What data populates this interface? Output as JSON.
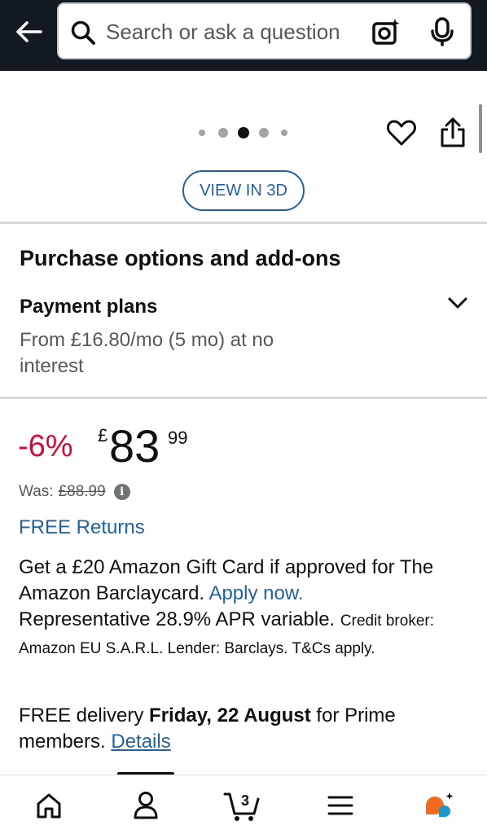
{
  "header": {
    "search_placeholder": "Search or ask a question",
    "back_icon": "arrow-left-icon",
    "search_icon": "magnifier-icon",
    "camera_icon": "camera-sparkle-icon",
    "mic_icon": "microphone-icon"
  },
  "gallery": {
    "dots_total": 5,
    "active_dot": 3,
    "view3d_label": "VIEW IN 3D",
    "wishlist_icon": "heart-icon",
    "share_icon": "share-icon"
  },
  "purchase": {
    "title": "Purchase options and add-ons",
    "payment_title": "Payment plans",
    "payment_desc": "From £16.80/mo (5 mo) at no interest"
  },
  "price": {
    "discount": "-6%",
    "currency": "£",
    "whole": "83",
    "fraction": "99",
    "was_label": "Was:",
    "was_price": "£88.99"
  },
  "returns": "FREE Returns",
  "giftcard": {
    "text": "Get a £20 Amazon Gift Card if approved for The Amazon Barclaycard. ",
    "link": "Apply now.",
    "apr": "Representative 28.9% APR variable. ",
    "small": "Credit broker: Amazon EU S.A.R.L. Lender: Barclays. T&Cs apply."
  },
  "delivery": {
    "prefix": "FREE delivery ",
    "date": "Friday, 22 August",
    "suffix": " for Prime members. ",
    "link": "Details"
  },
  "bottom_nav": {
    "cart_count": "3",
    "items": [
      "home-icon",
      "account-icon",
      "cart-icon",
      "menu-icon",
      "rufus-icon"
    ]
  },
  "colors": {
    "header_bg": "#131921",
    "link": "#2162a1",
    "discount": "#cc0c39",
    "rufus_orange": "#f26b1d",
    "rufus_teal": "#1a98c7"
  }
}
